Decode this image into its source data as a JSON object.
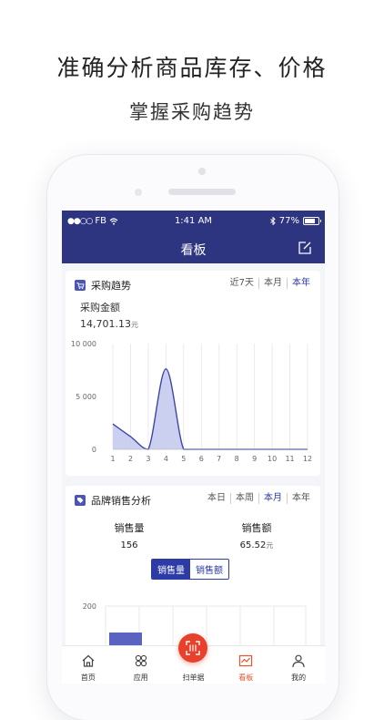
{
  "promo": {
    "headline": "准确分析商品库存、价格",
    "subheadline": "掌握采购趋势"
  },
  "status_bar": {
    "carrier": "FB",
    "time": "1:41 AM",
    "battery": "77%",
    "battery_level": 0.77
  },
  "nav": {
    "title": "看板"
  },
  "purchase_card": {
    "title": "采购趋势",
    "tabs": [
      "近7天",
      "本月",
      "本年"
    ],
    "active_tab": 2,
    "amount_label": "采购金额",
    "amount_value": "14,701.13",
    "amount_unit": "元"
  },
  "chart_data": {
    "type": "area",
    "x": [
      1,
      2,
      3,
      4,
      5,
      6,
      7,
      8,
      9,
      10,
      11,
      12
    ],
    "x_ticks": [
      "1",
      "2",
      "3",
      "4",
      "5",
      "6",
      "7",
      "8",
      "9",
      "10",
      "11",
      "12"
    ],
    "values": [
      2400,
      1200,
      0,
      7600,
      0,
      0,
      0,
      0,
      0,
      0,
      0,
      0
    ],
    "ylim": [
      0,
      10000
    ],
    "y_ticks": [
      "10 000",
      "5 000",
      "0"
    ],
    "y_tick_values": [
      10000,
      5000,
      0
    ],
    "grid": true,
    "color": "#3d46a6",
    "fill": "#c7cbee"
  },
  "brand_card": {
    "title": "品牌销售分析",
    "tabs": [
      "本日",
      "本周",
      "本月",
      "本年"
    ],
    "active_tab": 2,
    "qty_label": "销售量",
    "qty_value": "156",
    "amount_label": "销售额",
    "amount_value": "65.52",
    "amount_unit": "元",
    "toggle": [
      "销售量",
      "销售额"
    ],
    "toggle_active": 0,
    "bar_chart": {
      "y_tick": "200",
      "y_tick_value": 200,
      "color": "#5a63c2"
    }
  },
  "tabbar": {
    "items": [
      {
        "label": "首页",
        "icon": "home-icon"
      },
      {
        "label": "应用",
        "icon": "apps-icon"
      },
      {
        "label": "扫单据",
        "icon": "scan-icon"
      },
      {
        "label": "看板",
        "icon": "dashboard-icon"
      },
      {
        "label": "我的",
        "icon": "profile-icon"
      }
    ],
    "active": 3,
    "accent": "#e8542c"
  },
  "colors": {
    "nav_bg": "#2d3480",
    "accent_blue": "#2d3ba6",
    "scan_red": "#e8402a"
  }
}
